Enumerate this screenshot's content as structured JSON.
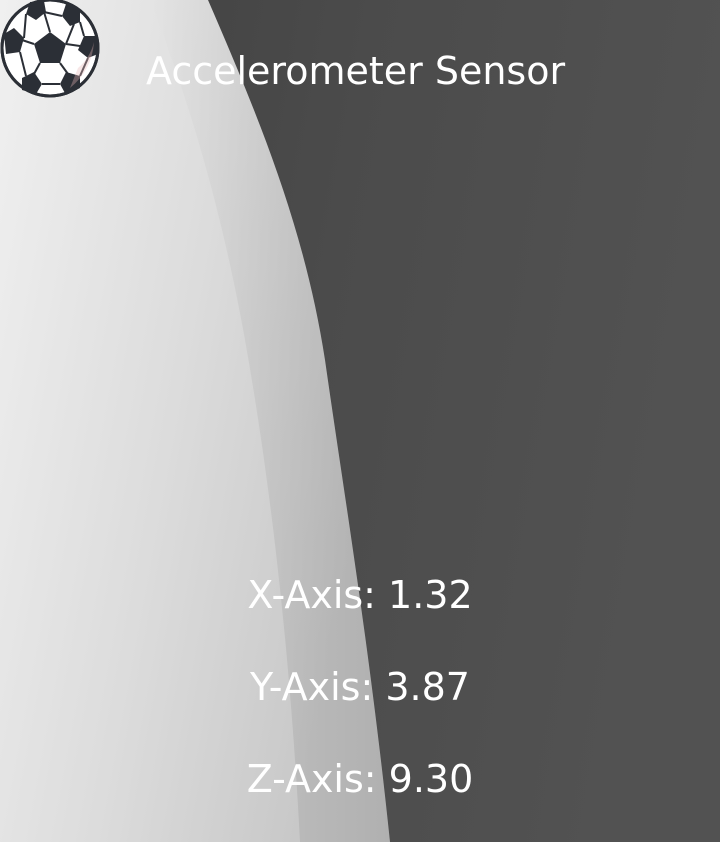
{
  "app": {
    "title": "Accelerometer Sensor"
  },
  "readings": {
    "x_label": "X-Axis: 1.32",
    "y_label": "Y-Axis: 3.87",
    "z_label": "Z-Axis: 9.30"
  },
  "ball": {
    "icon": "soccer-ball-icon"
  },
  "colors": {
    "text": "#ffffff",
    "background_dark": "#4a4a4a",
    "background_light": "#f2f2f2"
  }
}
